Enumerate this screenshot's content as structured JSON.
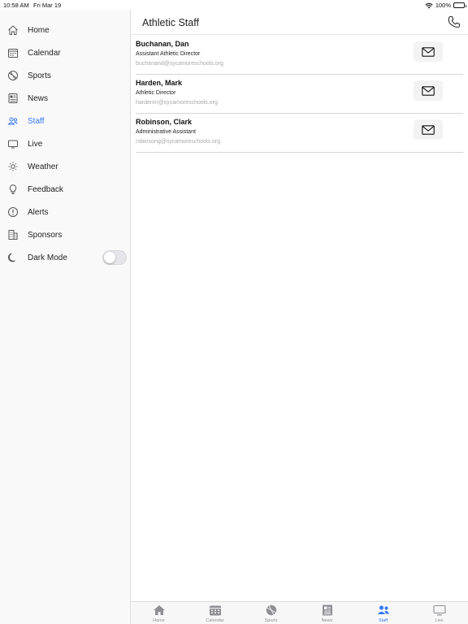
{
  "status_bar": {
    "time": "10:58 AM",
    "date": "Fri Mar 19",
    "battery": "100%"
  },
  "sidebar": {
    "items": [
      {
        "label": "Home",
        "icon": "house-icon"
      },
      {
        "label": "Calendar",
        "icon": "calendar-icon"
      },
      {
        "label": "Sports",
        "icon": "basketball-icon"
      },
      {
        "label": "News",
        "icon": "newspaper-icon"
      },
      {
        "label": "Staff",
        "icon": "people-icon"
      },
      {
        "label": "Live",
        "icon": "tv-icon"
      },
      {
        "label": "Weather",
        "icon": "sun-icon"
      },
      {
        "label": "Feedback",
        "icon": "lightbulb-icon"
      },
      {
        "label": "Alerts",
        "icon": "exclamation-icon"
      },
      {
        "label": "Sponsors",
        "icon": "building-icon"
      },
      {
        "label": "Dark Mode",
        "icon": "moon-icon"
      }
    ],
    "active": "Staff",
    "dark_mode_on": false
  },
  "header": {
    "title": "Athletic Staff"
  },
  "staff": [
    {
      "name": "Buchanan, Dan",
      "title": "Assistant Athletic Director",
      "email": "buchanand@sycamoreschools.org"
    },
    {
      "name": "Harden, Mark",
      "title": "Athletic Director",
      "email": "hardenm@sycamoreschools.org"
    },
    {
      "name": "Robinson, Clark",
      "title": "Administrative Assistant",
      "email": "robinsong@sycamoreschools.org"
    }
  ],
  "tabs": [
    {
      "label": "Home",
      "icon": "house-icon"
    },
    {
      "label": "Calendar",
      "icon": "calendar-icon"
    },
    {
      "label": "Sports",
      "icon": "basketball-icon"
    },
    {
      "label": "News",
      "icon": "newspaper-icon"
    },
    {
      "label": "Staff",
      "icon": "people-icon"
    },
    {
      "label": "Live",
      "icon": "tv-icon"
    }
  ],
  "colors": {
    "accent": "#3478f6",
    "inactive": "#8e8e93"
  }
}
